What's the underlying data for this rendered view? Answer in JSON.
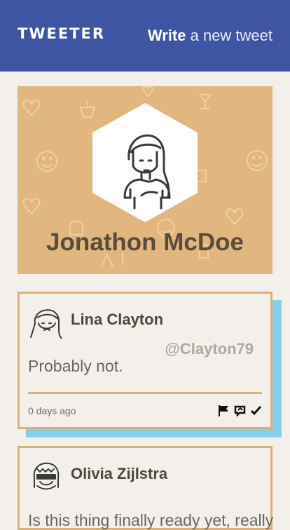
{
  "header": {
    "logo": "TWEETER",
    "write_bold": "Write",
    "write_rest": " a new tweet"
  },
  "profile": {
    "name": "Jonathon McDoe",
    "background_color": "#e1b77f"
  },
  "tweets": [
    {
      "author": "Lina Clayton",
      "handle": "@Clayton79",
      "text": "Probably not.",
      "time": "0 days ago",
      "actions": [
        "flag-icon",
        "retweet-icon",
        "check-icon"
      ]
    },
    {
      "author": "Olivia Zijlstra",
      "text": "Is this thing finally ready yet, really"
    }
  ],
  "colors": {
    "header": "#3d55a3",
    "accent_border": "#dcb07a",
    "shadow": "#86cfe8",
    "page_bg": "#f3f0eb"
  }
}
